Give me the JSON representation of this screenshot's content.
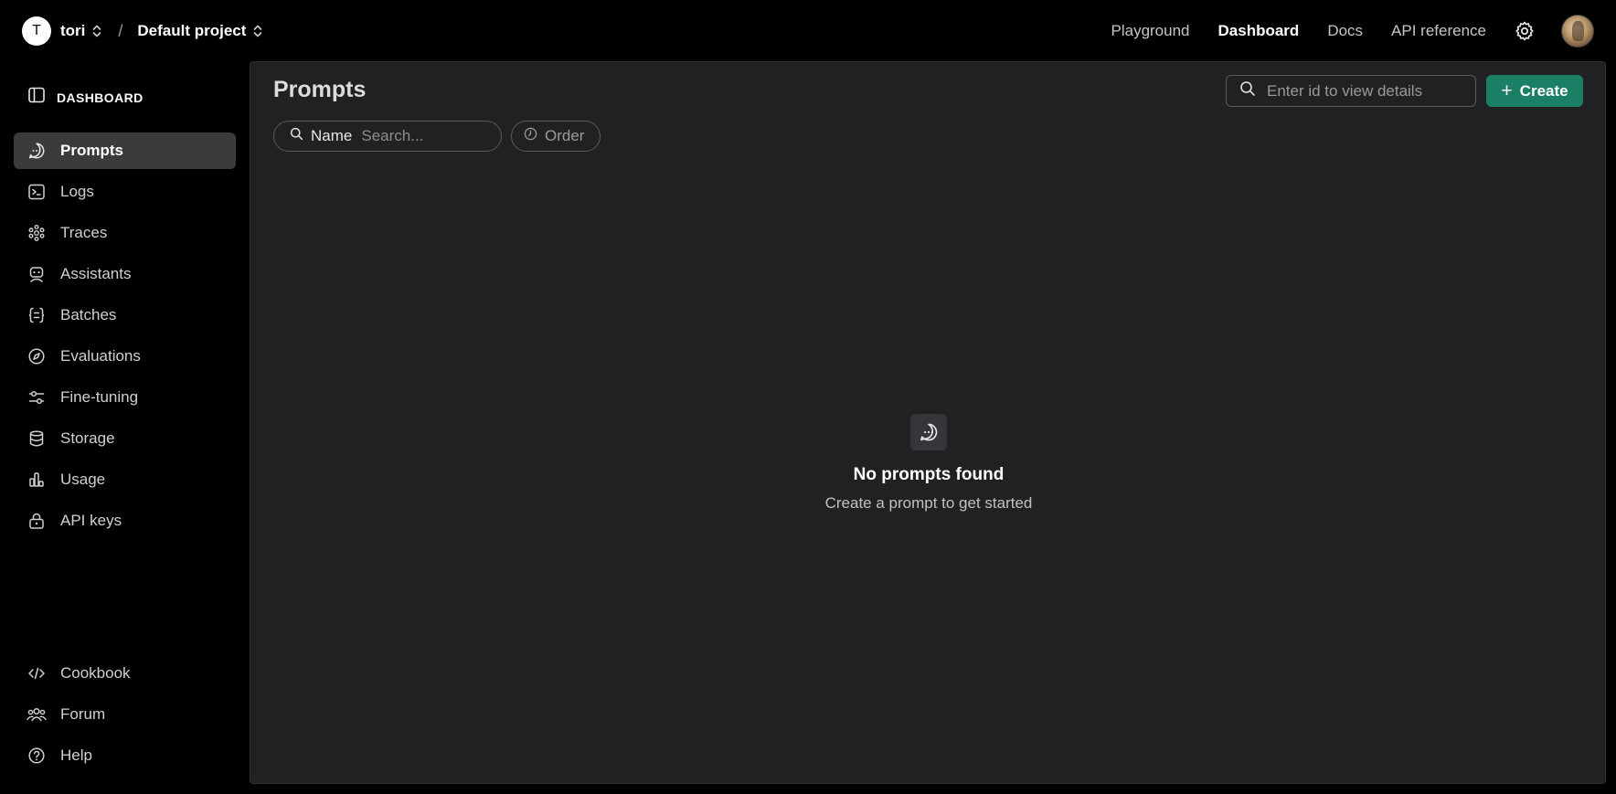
{
  "header": {
    "org_initial": "T",
    "org_name": "tori",
    "separator": "/",
    "project_name": "Default project",
    "nav": [
      {
        "label": "Playground",
        "active": false
      },
      {
        "label": "Dashboard",
        "active": true
      },
      {
        "label": "Docs",
        "active": false
      },
      {
        "label": "API reference",
        "active": false
      }
    ]
  },
  "sidebar": {
    "title": "DASHBOARD",
    "items": [
      {
        "label": "Prompts",
        "icon": "chat-bubble-icon",
        "active": true
      },
      {
        "label": "Logs",
        "icon": "terminal-icon",
        "active": false
      },
      {
        "label": "Traces",
        "icon": "traces-icon",
        "active": false
      },
      {
        "label": "Assistants",
        "icon": "robot-icon",
        "active": false
      },
      {
        "label": "Batches",
        "icon": "braces-icon",
        "active": false
      },
      {
        "label": "Evaluations",
        "icon": "compass-icon",
        "active": false
      },
      {
        "label": "Fine-tuning",
        "icon": "sliders-icon",
        "active": false
      },
      {
        "label": "Storage",
        "icon": "database-icon",
        "active": false
      },
      {
        "label": "Usage",
        "icon": "bar-chart-icon",
        "active": false
      },
      {
        "label": "API keys",
        "icon": "lock-icon",
        "active": false
      }
    ],
    "bottom_items": [
      {
        "label": "Cookbook",
        "icon": "code-icon"
      },
      {
        "label": "Forum",
        "icon": "people-icon"
      },
      {
        "label": "Help",
        "icon": "help-icon"
      }
    ]
  },
  "main": {
    "title": "Prompts",
    "id_search_placeholder": "Enter id to view details",
    "create_label": "Create",
    "filter_name_label": "Name",
    "filter_search_placeholder": "Search...",
    "order_label": "Order",
    "empty_title": "No prompts found",
    "empty_subtitle": "Create a prompt to get started"
  },
  "colors": {
    "accent": "#1a7f64",
    "background": "#000000",
    "panel": "#212124",
    "active_item": "#3b3b3d"
  }
}
